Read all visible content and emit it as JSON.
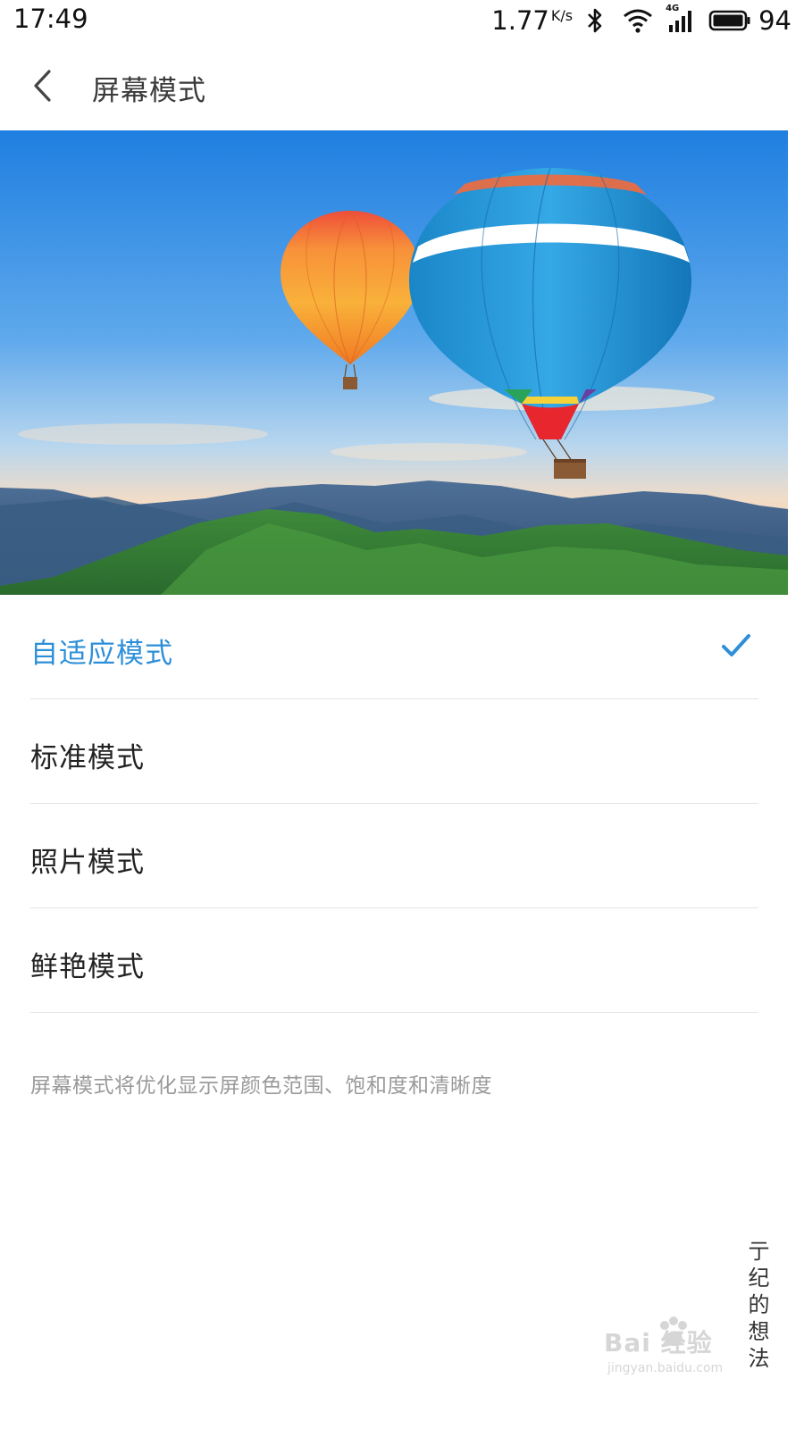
{
  "status_bar": {
    "time": "17:49",
    "net_speed": "1.77",
    "net_unit": "K/s",
    "network_type": "4G",
    "battery_level": "94",
    "icons": [
      "bluetooth-icon",
      "wifi-icon",
      "cellular-4g-icon",
      "battery-icon"
    ]
  },
  "header": {
    "back_icon": "chevron-left-icon",
    "title": "屏幕模式"
  },
  "preview": {
    "description": "hot-air-balloons-over-mountains"
  },
  "modes": [
    {
      "label": "自适应模式",
      "selected": true
    },
    {
      "label": "标准模式",
      "selected": false
    },
    {
      "label": "照片模式",
      "selected": false
    },
    {
      "label": "鲜艳模式",
      "selected": false
    }
  ],
  "description": "屏幕模式将优化显示屏颜色范围、饱和度和清晰度",
  "watermark": {
    "brand": "Bai 经验",
    "url": "jingyan.baidu.com",
    "signature": "亍纪的想法"
  },
  "colors": {
    "accent": "#2d8fd8",
    "text_primary": "#222222",
    "text_secondary": "#9a9a9a",
    "divider": "#e4e4e4"
  }
}
